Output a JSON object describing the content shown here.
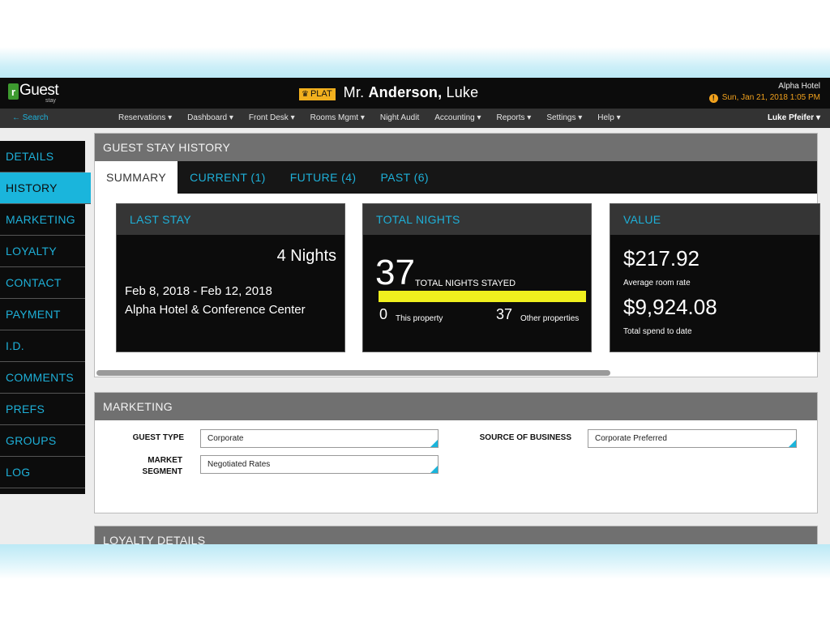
{
  "app": {
    "logo_text": "Guest",
    "logo_letter": "r",
    "logo_sub": "stay",
    "guest": {
      "tier": "PLAT",
      "prefix": "Mr.",
      "last_name": "Anderson,",
      "first_name": "Luke"
    },
    "hotel": {
      "name": "Alpha Hotel",
      "datetime": "Sun, Jan 21, 2018 1:05 PM"
    }
  },
  "nav": {
    "search": "← Search",
    "items": [
      {
        "label": "Reservations ▾"
      },
      {
        "label": "Dashboard ▾"
      },
      {
        "label": "Front Desk ▾"
      },
      {
        "label": "Rooms Mgmt ▾"
      },
      {
        "label": "Night Audit"
      },
      {
        "label": "Accounting ▾"
      },
      {
        "label": "Reports ▾"
      },
      {
        "label": "Settings ▾"
      },
      {
        "label": "Help ▾"
      }
    ],
    "user": "Luke Pfeifer ▾"
  },
  "sidebar": {
    "items": [
      {
        "label": "DETAILS"
      },
      {
        "label": "HISTORY",
        "active": true
      },
      {
        "label": "MARKETING"
      },
      {
        "label": "LOYALTY"
      },
      {
        "label": "CONTACT"
      },
      {
        "label": "PAYMENT"
      },
      {
        "label": "I.D."
      },
      {
        "label": "COMMENTS"
      },
      {
        "label": "PREFS"
      },
      {
        "label": "GROUPS"
      },
      {
        "label": "LOG"
      }
    ]
  },
  "history": {
    "title": "GUEST STAY HISTORY",
    "tabs": [
      {
        "label": "SUMMARY",
        "active": true
      },
      {
        "label": "CURRENT (1)"
      },
      {
        "label": "FUTURE (4)"
      },
      {
        "label": "PAST (6)"
      }
    ],
    "last_stay": {
      "title": "LAST STAY",
      "nights": "4 Nights",
      "dates": "Feb 8, 2018 - Feb 12, 2018",
      "hotel": "Alpha Hotel & Conference Center"
    },
    "total_nights": {
      "title": "TOTAL NIGHTS",
      "total": "37",
      "total_label": "TOTAL NIGHTS STAYED",
      "this_count": "0",
      "this_label": "This property",
      "other_count": "37",
      "other_label": "Other properties",
      "other_fraction": 1.0
    },
    "value": {
      "title": "VALUE",
      "avg_rate": "$217.92",
      "avg_rate_label": "Average room rate",
      "total_spend": "$9,924.08",
      "total_spend_label": "Total spend to date"
    }
  },
  "marketing": {
    "title": "MARKETING",
    "guest_type_label": "GUEST TYPE",
    "guest_type_value": "Corporate",
    "market_segment_label_1": "MARKET",
    "market_segment_label_2": "SEGMENT",
    "market_segment_value": "Negotiated Rates",
    "source_label": "SOURCE OF BUSINESS",
    "source_value": "Corporate Preferred"
  },
  "loyalty": {
    "title": "LOYALTY DETAILS"
  },
  "colors": {
    "accent": "#1ab5dc",
    "gold": "#f2b01e",
    "bar": "#f0f01e",
    "dark": "#0c0c0c"
  }
}
